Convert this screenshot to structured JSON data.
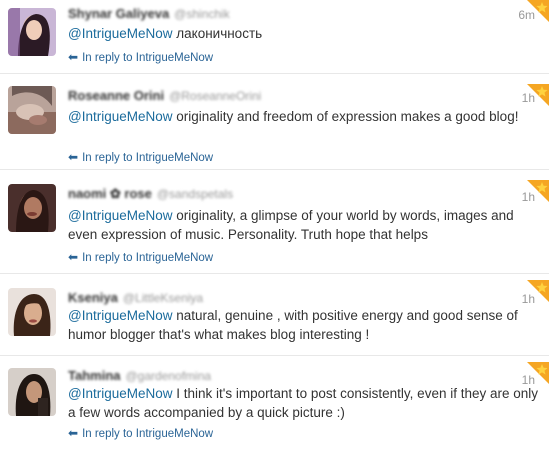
{
  "tweets": [
    {
      "name": "Shynar Galiyeva",
      "handle": "@shinchik",
      "time": "6m",
      "mention": "@IntrigueMeNow",
      "text": " лаконичность",
      "reply_label": "In reply to IntrigueMeNow"
    },
    {
      "name": "Roseanne Orini",
      "handle": "@RoseanneOrini",
      "time": "1h",
      "mention": "@IntrigueMeNow",
      "text": " originality and freedom of expression makes a good blog!",
      "reply_label": "In reply to IntrigueMeNow"
    },
    {
      "name": "naomi ✿ rose",
      "handle": "@sandspetals",
      "time": "1h",
      "mention": "@IntrigueMeNow",
      "text": " originality, a glimpse of your world by words, images and even expression of music. Personality. Truth hope that helps",
      "reply_label": "In reply to IntrigueMeNow"
    },
    {
      "name": "Kseniya",
      "handle": "@LittleKseniya",
      "time": "1h",
      "mention": "@IntrigueMeNow",
      "text": " natural, genuine , with positive energy and good sense of humor blogger that's what makes blog interesting !",
      "reply_label": ""
    },
    {
      "name": "Tahmina",
      "handle": "@gardenofmina",
      "time": "1h",
      "mention": "@IntrigueMeNow",
      "text": " I think it's important to post consistently, even if they are only a few words accompanied by a quick picture :)",
      "reply_label": "In reply to IntrigueMeNow"
    }
  ],
  "colors": {
    "mention": "#1b6b9c",
    "reply_link": "#2a6496",
    "star_orange": "#f5a623",
    "star_yellow": "#ffd23f"
  },
  "icons": {
    "reply": "reply-arrow-icon",
    "favorite": "star-icon"
  }
}
